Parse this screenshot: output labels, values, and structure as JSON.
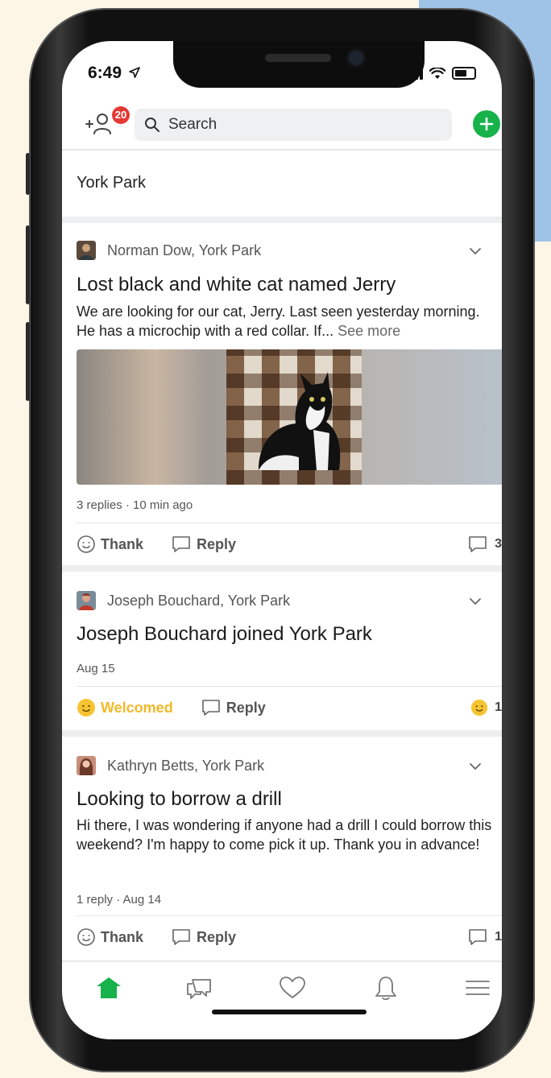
{
  "status_bar": {
    "time": "6:49"
  },
  "header": {
    "notification_count": "20",
    "search_placeholder": "Search"
  },
  "neighborhood": "York Park",
  "posts": [
    {
      "author": "Norman Dow, York Park",
      "title": "Lost black and white cat named Jerry",
      "body": "We are looking for our cat, Jerry. Last seen yesterday morning. He has a microchip with a red collar. If...",
      "see_more": "See more",
      "meta": "3 replies · 10 min ago",
      "thank_label": "Thank",
      "reply_label": "Reply",
      "reply_count": "3"
    },
    {
      "author": "Joseph Bouchard, York Park",
      "title": "Joseph Bouchard joined York Park",
      "meta": "Aug 15",
      "welcomed_label": "Welcomed",
      "reply_label": "Reply",
      "welcome_count": "1"
    },
    {
      "author": "Kathryn Betts, York Park",
      "title": "Looking to borrow a drill",
      "body": "Hi there, I was wondering if anyone had a drill I could borrow this weekend? I'm happy to come pick it up. Thank you in advance!",
      "meta": "1 reply · Aug 14",
      "thank_label": "Thank",
      "reply_label": "Reply",
      "reply_count": "1"
    }
  ],
  "tabbar": {
    "icons": [
      "home-icon",
      "chat-icon",
      "heart-icon",
      "bell-icon",
      "menu-icon"
    ],
    "active": "home-icon"
  },
  "colors": {
    "brand_green": "#17b24a",
    "badge_red": "#e53935",
    "welcome_yellow": "#f2b827"
  }
}
